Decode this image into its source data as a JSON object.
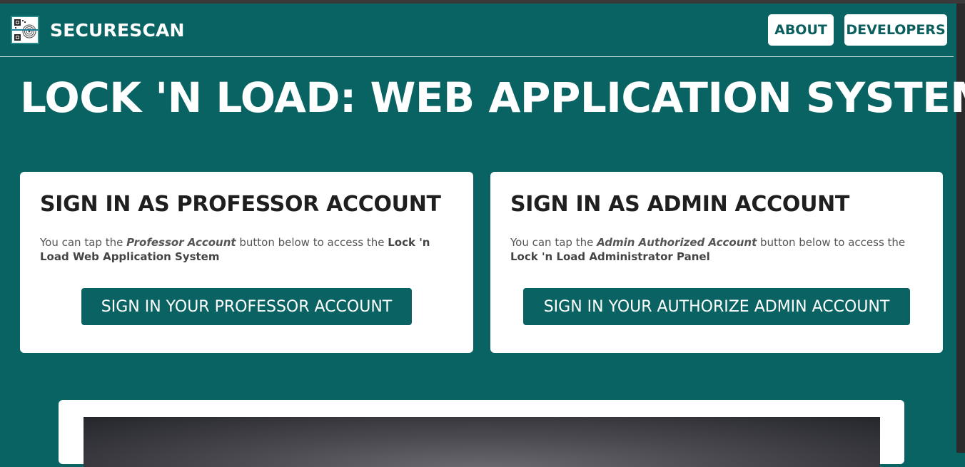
{
  "app": {
    "brand_name": "SECURESCAN",
    "logo_icon": "qr-fingerprint-logo-icon"
  },
  "nav": {
    "about_label": "ABOUT",
    "developers_label": "DEVELOPERS"
  },
  "page": {
    "title": "LOCK 'N LOAD: WEB APPLICATION SYSTEM"
  },
  "cards": {
    "professor": {
      "title": "SIGN IN AS PROFESSOR ACCOUNT",
      "desc_prefix": "You can tap the ",
      "desc_emphasis": "Professor Account",
      "desc_middle": " button below to access the ",
      "desc_target": "Lock 'n Load Web Application System",
      "button_label": "SIGN IN YOUR PROFESSOR ACCOUNT"
    },
    "admin": {
      "title": "SIGN IN AS ADMIN ACCOUNT",
      "desc_prefix": "You can tap the ",
      "desc_emphasis": "Admin Authorized Account",
      "desc_middle": " button below to access the ",
      "desc_target": "Lock 'n Load Administrator Panel",
      "button_label": "SIGN IN YOUR AUTHORIZE ADMIN ACCOUNT"
    }
  },
  "colors": {
    "background": "#096363",
    "button": "#0b6262",
    "card": "#ffffff",
    "brand_text": "#ffffff"
  }
}
